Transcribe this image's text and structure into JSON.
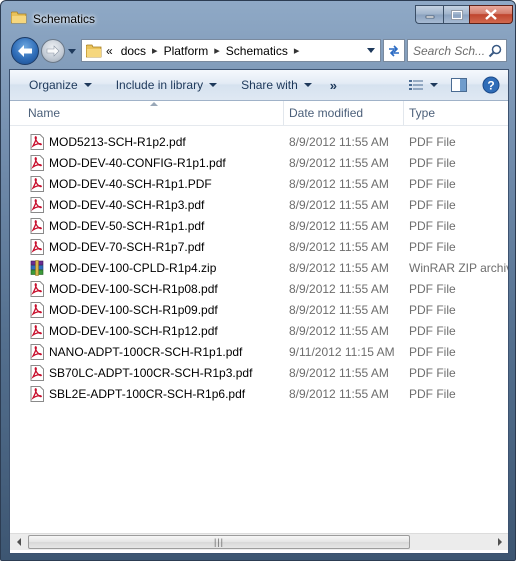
{
  "window": {
    "title": "Schematics",
    "caption_buttons": [
      "minimize-icon",
      "maximize-icon",
      "close-icon"
    ]
  },
  "nav": {
    "breadcrumbs": [
      "docs",
      "Platform",
      "Schematics"
    ],
    "overflow_marker": "«",
    "search_placeholder": "Search Sch..."
  },
  "toolbar": {
    "organize": "Organize",
    "include_in_library": "Include in library",
    "share_with": "Share with",
    "more": "»"
  },
  "columns": {
    "name": "Name",
    "date_modified": "Date modified",
    "type": "Type"
  },
  "files": [
    {
      "name": "MOD5213-SCH-R1p2.pdf",
      "date": "8/9/2012 11:55 AM",
      "type": "PDF File",
      "icon": "pdf-icon"
    },
    {
      "name": "MOD-DEV-40-CONFIG-R1p1.pdf",
      "date": "8/9/2012 11:55 AM",
      "type": "PDF File",
      "icon": "pdf-icon"
    },
    {
      "name": "MOD-DEV-40-SCH-R1p1.PDF",
      "date": "8/9/2012 11:55 AM",
      "type": "PDF File",
      "icon": "pdf-icon"
    },
    {
      "name": "MOD-DEV-40-SCH-R1p3.pdf",
      "date": "8/9/2012 11:55 AM",
      "type": "PDF File",
      "icon": "pdf-icon"
    },
    {
      "name": "MOD-DEV-50-SCH-R1p1.pdf",
      "date": "8/9/2012 11:55 AM",
      "type": "PDF File",
      "icon": "pdf-icon"
    },
    {
      "name": "MOD-DEV-70-SCH-R1p7.pdf",
      "date": "8/9/2012 11:55 AM",
      "type": "PDF File",
      "icon": "pdf-icon"
    },
    {
      "name": "MOD-DEV-100-CPLD-R1p4.zip",
      "date": "8/9/2012 11:55 AM",
      "type": "WinRAR ZIP archive",
      "icon": "winrar-icon"
    },
    {
      "name": "MOD-DEV-100-SCH-R1p08.pdf",
      "date": "8/9/2012 11:55 AM",
      "type": "PDF File",
      "icon": "pdf-icon"
    },
    {
      "name": "MOD-DEV-100-SCH-R1p09.pdf",
      "date": "8/9/2012 11:55 AM",
      "type": "PDF File",
      "icon": "pdf-icon"
    },
    {
      "name": "MOD-DEV-100-SCH-R1p12.pdf",
      "date": "8/9/2012 11:55 AM",
      "type": "PDF File",
      "icon": "pdf-icon"
    },
    {
      "name": "NANO-ADPT-100CR-SCH-R1p1.pdf",
      "date": "9/11/2012 11:15 AM",
      "type": "PDF File",
      "icon": "pdf-icon"
    },
    {
      "name": "SB70LC-ADPT-100CR-SCH-R1p3.pdf",
      "date": "8/9/2012 11:55 AM",
      "type": "PDF File",
      "icon": "pdf-icon"
    },
    {
      "name": "SBL2E-ADPT-100CR-SCH-R1p6.pdf",
      "date": "8/9/2012 11:55 AM",
      "type": "PDF File",
      "icon": "pdf-icon"
    }
  ],
  "colors": {
    "toolbar_text": "#1e395b",
    "secondary_text": "#6d6d6d",
    "header_text": "#4c607a",
    "pdf_red": "#c8102e"
  }
}
